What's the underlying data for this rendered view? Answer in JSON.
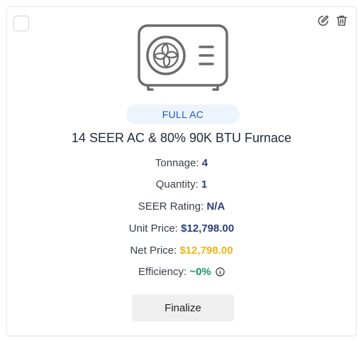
{
  "product": {
    "badge": "FULL AC",
    "title": "14 SEER AC & 80% 90K BTU Furnace",
    "tonnage_label": "Tonnage:",
    "tonnage_value": "4",
    "quantity_label": "Quantity:",
    "quantity_value": "1",
    "seer_label": "SEER Rating:",
    "seer_value": "N/A",
    "unit_price_label": "Unit Price:",
    "unit_price_value": "$12,798.00",
    "net_price_label": "Net Price:",
    "net_price_value": "$12,798.00",
    "efficiency_label": "Efficiency:",
    "efficiency_value": "~0%"
  },
  "actions": {
    "finalize_label": "Finalize"
  },
  "icons": {
    "product_image": "ac-condenser-unit-icon",
    "edit": "edit-icon",
    "delete": "trash-icon",
    "info": "info-icon"
  },
  "colors": {
    "badge_bg": "#eef4fc",
    "badge_text": "#1f57c3",
    "value_text": "#2d3f7a",
    "net_price": "#f1b41a",
    "efficiency": "#16956b",
    "button_bg": "#efefef"
  }
}
